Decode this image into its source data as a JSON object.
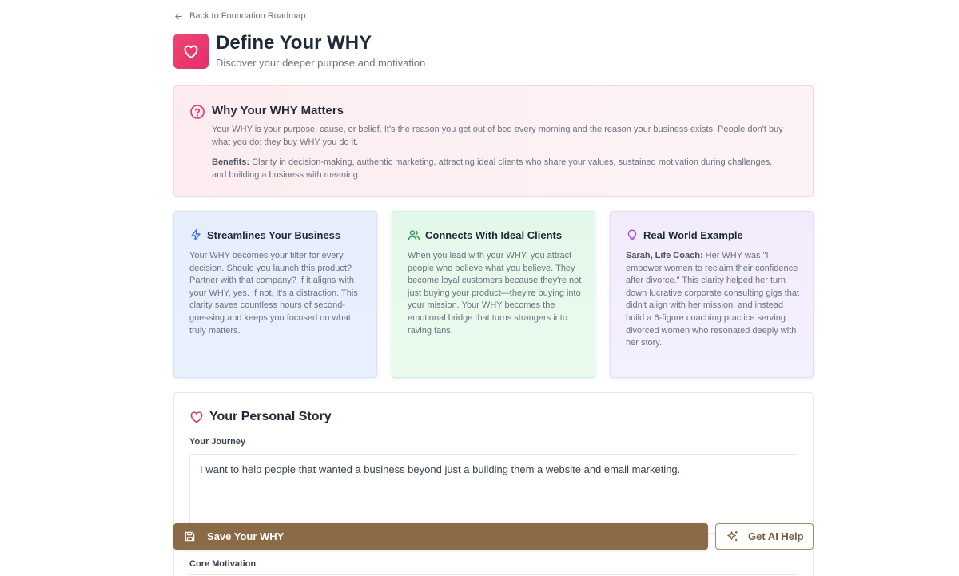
{
  "nav": {
    "back_label": "Back to Foundation Roadmap"
  },
  "header": {
    "title": "Define Your WHY",
    "subtitle": "Discover your deeper purpose and motivation",
    "accent": "#e8366d"
  },
  "why_matters": {
    "title": "Why Your WHY Matters",
    "paragraph": "Your WHY is your purpose, cause, or belief. It's the reason you get out of bed every morning and the reason your business exists. People don't buy what you do; they buy WHY you do it.",
    "benefits_label": "Benefits:",
    "benefits_text": " Clarity in decision-making, authentic marketing, attracting ideal clients who share your values, sustained motivation during challenges, and building a business with meaning."
  },
  "cards": [
    {
      "icon": "lightning-icon",
      "title": "Streamlines Your Business",
      "body": "Your WHY becomes your filter for every decision. Should you launch this product? Partner with that company? If it aligns with your WHY, yes. If not, it's a distraction. This clarity saves countless hours of second-guessing and keeps you focused on what truly matters."
    },
    {
      "icon": "users-icon",
      "title": "Connects With Ideal Clients",
      "body": "When you lead with your WHY, you attract people who believe what you believe. They become loyal customers because they're not just buying your product—they're buying into your mission. Your WHY becomes the emotional bridge that turns strangers into raving fans."
    },
    {
      "icon": "lightbulb-icon",
      "title": "Real World Example",
      "body_label": "Sarah, Life Coach:",
      "body": " Her WHY was \"I empower women to reclaim their confidence after divorce.\" This clarity helped her turn down lucrative corporate consulting gigs that didn't align with her mission, and instead build a 6-figure coaching practice serving divorced women who resonated deeply with her story."
    }
  ],
  "story": {
    "title": "Your Personal Story",
    "journey_label": "Your Journey",
    "journey_value": "I want to help people that wanted a business beyond just a building them a website and email marketing.",
    "core_label": "Core Motivation"
  },
  "actions": {
    "save_label": "Save Your WHY",
    "ai_label": "Get AI Help",
    "save_color": "#8b6b47"
  }
}
